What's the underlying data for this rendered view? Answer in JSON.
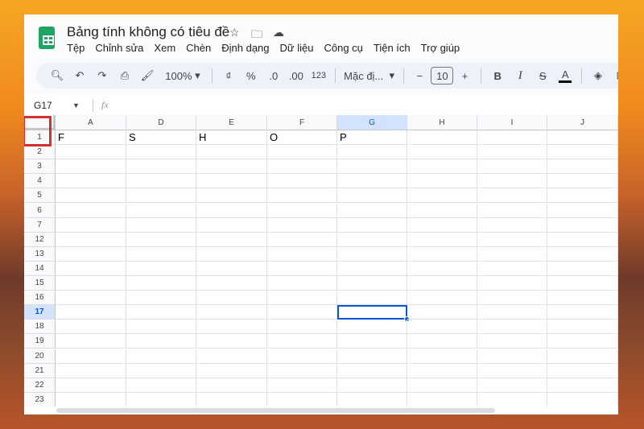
{
  "doc": {
    "title": "Bảng tính không có tiêu đề"
  },
  "menu": [
    "Tệp",
    "Chỉnh sửa",
    "Xem",
    "Chèn",
    "Định dạng",
    "Dữ liệu",
    "Công cụ",
    "Tiện ích",
    "Trợ giúp"
  ],
  "toolbar": {
    "zoom": "100%",
    "currency": "₫",
    "percent": "%",
    "dec_dec": ".0",
    "inc_dec": ".00",
    "format_123": "123",
    "font": "Mặc đị...",
    "font_size": "10",
    "minus": "−",
    "plus": "+",
    "bold": "B",
    "italic": "I",
    "text_color": "A"
  },
  "formula": {
    "name_box": "G17",
    "fx": "fx",
    "value": ""
  },
  "columns": [
    "A",
    "D",
    "E",
    "F",
    "G",
    "H",
    "I",
    "J"
  ],
  "rows": [
    "1",
    "2",
    "3",
    "4",
    "5",
    "6",
    "7",
    "12",
    "13",
    "14",
    "15",
    "16",
    "17",
    "18",
    "19",
    "20",
    "21",
    "22",
    "23"
  ],
  "cells": {
    "A1": "F",
    "D1": "S",
    "E1": "H",
    "F1": "O",
    "G1": "P"
  },
  "selected": "G17",
  "colors": {
    "accent": "#0b57d0",
    "selected_header": "#d3e3fd",
    "highlight_box": "#d32f2f"
  }
}
